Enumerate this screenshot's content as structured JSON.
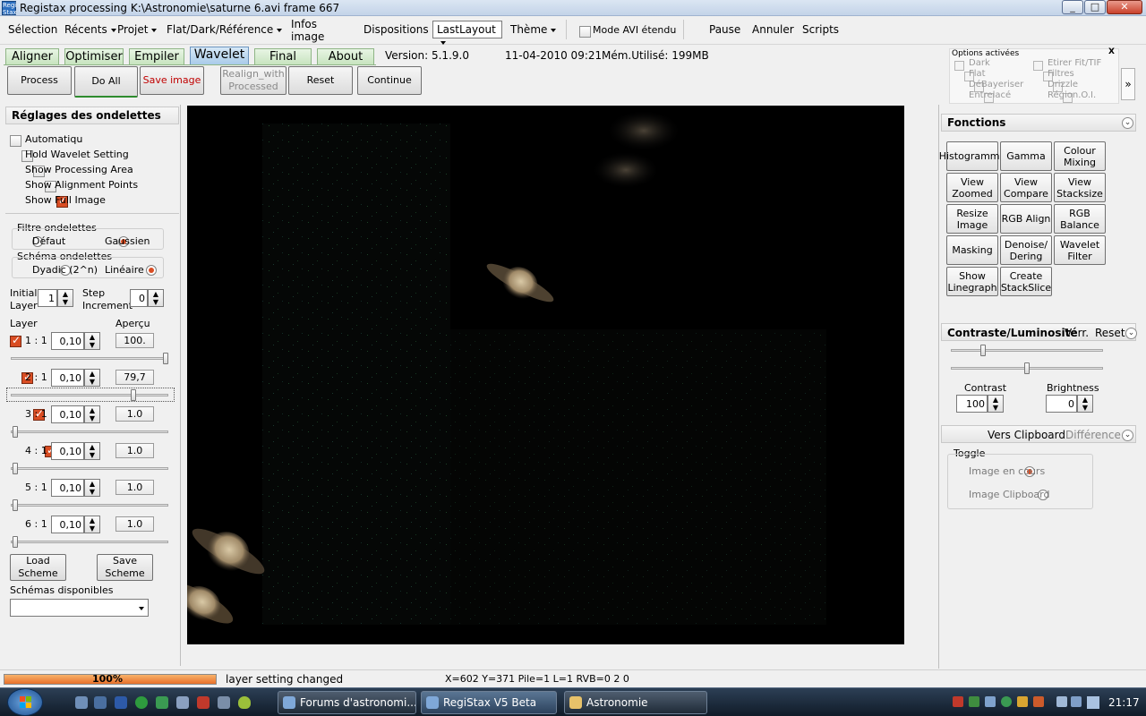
{
  "window": {
    "title": "Registax processing K:\\Astronomie\\saturne 6.avi frame 667",
    "app_icon_text": "Regi Stax",
    "controls": {
      "minimize": "_",
      "maximize": "□",
      "close": "✕"
    }
  },
  "menubar": {
    "items": [
      "Sélection",
      "Récents",
      "Projet",
      "Flat/Dark/Référence",
      "Infos image",
      "Dispositions"
    ],
    "layout_value": "LastLayout",
    "theme": "Thème",
    "avi_mode_label": "Mode AVI étendu",
    "pause": "Pause",
    "cancel": "Annuler",
    "scripts": "Scripts"
  },
  "tabs": [
    {
      "label": "Aligner",
      "active": false
    },
    {
      "label": "Optimiser",
      "active": false
    },
    {
      "label": "Empiler",
      "active": false
    },
    {
      "label": "Wavelet",
      "active": true
    },
    {
      "label": "Final",
      "active": false
    },
    {
      "label": "About",
      "active": false
    }
  ],
  "info": {
    "version": "Version: 5.1.9.0",
    "datetime": "11-04-2010 09:21",
    "memory": "Mém.Utilisé: 199MB"
  },
  "actions": {
    "process": "Process",
    "do_all": "Do All",
    "save_image": "Save image",
    "realign": "Realign_with Processed",
    "reset": "Reset",
    "continue": "Continue"
  },
  "options_active": {
    "title": "Options activées",
    "close": "X",
    "left": [
      "Dark",
      "Flat",
      "DéBayeriser",
      "Entrelacé"
    ],
    "right": [
      "Etirer Fit/TIF",
      "Filtres",
      "Drizzle",
      "Région.O.I."
    ],
    "expand": "»"
  },
  "wavelet": {
    "title": "Réglages des ondelettes",
    "checkboxes": [
      {
        "label": "Automatiqu",
        "checked": false
      },
      {
        "label": "Hold Wavelet Setting",
        "checked": false
      },
      {
        "label": "Show Processing Area",
        "checked": false
      },
      {
        "label": "Show Alignment Points",
        "checked": false
      },
      {
        "label": "Show Full Image",
        "checked": true
      }
    ],
    "filter": {
      "title": "Filtre ondelettes",
      "opt1": "Défaut",
      "opt2": "Gaussien",
      "selected": "Gaussien"
    },
    "scheme": {
      "title": "Schéma ondelettes",
      "opt1": "Dyadic (2^n)",
      "opt2": "Linéaire",
      "selected": "Linéaire"
    },
    "initial_layer_label": "Initial Layer",
    "initial_layer_value": "1",
    "step_increment_label": "Step Increment",
    "step_increment_value": "0",
    "layer_header": "Layer",
    "preview_header": "Aperçu",
    "layers": [
      {
        "label": "1 : 1",
        "denoise": "0,10",
        "value": "100.",
        "level": 1.0
      },
      {
        "label": "2 : 1",
        "denoise": "0,10",
        "value": "79,7",
        "level": 0.79
      },
      {
        "label": "3 : 1",
        "denoise": "0,10",
        "value": "1.0",
        "level": 0.01
      },
      {
        "label": "4 : 1",
        "denoise": "0,10",
        "value": "1.0",
        "level": 0.01
      },
      {
        "label": "5 : 1",
        "denoise": "0,10",
        "value": "1.0",
        "level": 0.01
      },
      {
        "label": "6 : 1",
        "denoise": "0,10",
        "value": "1.0",
        "level": 0.01
      }
    ],
    "load_scheme": "Load Scheme",
    "save_scheme": "Save Scheme",
    "available_schemes": "Schémas disponibles"
  },
  "functions": {
    "title": "Fonctions",
    "buttons": [
      "Histogramme",
      "Gamma",
      "Colour Mixing",
      "View Zoomed",
      "View Compare",
      "View Stacksize",
      "Resize Image",
      "RGB Align",
      "RGB Balance",
      "Masking",
      "Denoise/ Dering",
      "Wavelet Filter",
      "Show Linegraph",
      "Create StackSlice"
    ]
  },
  "contrast": {
    "title": "Contraste/Luminosité",
    "lock": "Verr.",
    "reset": "Reset",
    "contrast_label": "Contrast",
    "contrast_value": "100",
    "brightness_label": "Brightness",
    "brightness_value": "0",
    "contrast_level": 0.2,
    "brightness_level": 0.5
  },
  "clipboard": {
    "title": "Vers Clipboard",
    "diff": "Différence",
    "toggle_title": "Toggle",
    "opt1": "Image en cours",
    "opt2": "Image Clipboard",
    "selected": "Image en cours"
  },
  "status": {
    "progress_label": "100%",
    "progress": 1.0,
    "message": "layer setting changed",
    "coords": "X=602 Y=371  Pile=1  L=1  RVB=0 2 0"
  },
  "taskbar": {
    "start": "Start",
    "tasks": [
      {
        "label": "Forums d'astronomi...",
        "active": false
      },
      {
        "label": "RegiStax V5 Beta",
        "active": true
      },
      {
        "label": "Astronomie",
        "active": false
      }
    ],
    "clock": "21:17"
  }
}
